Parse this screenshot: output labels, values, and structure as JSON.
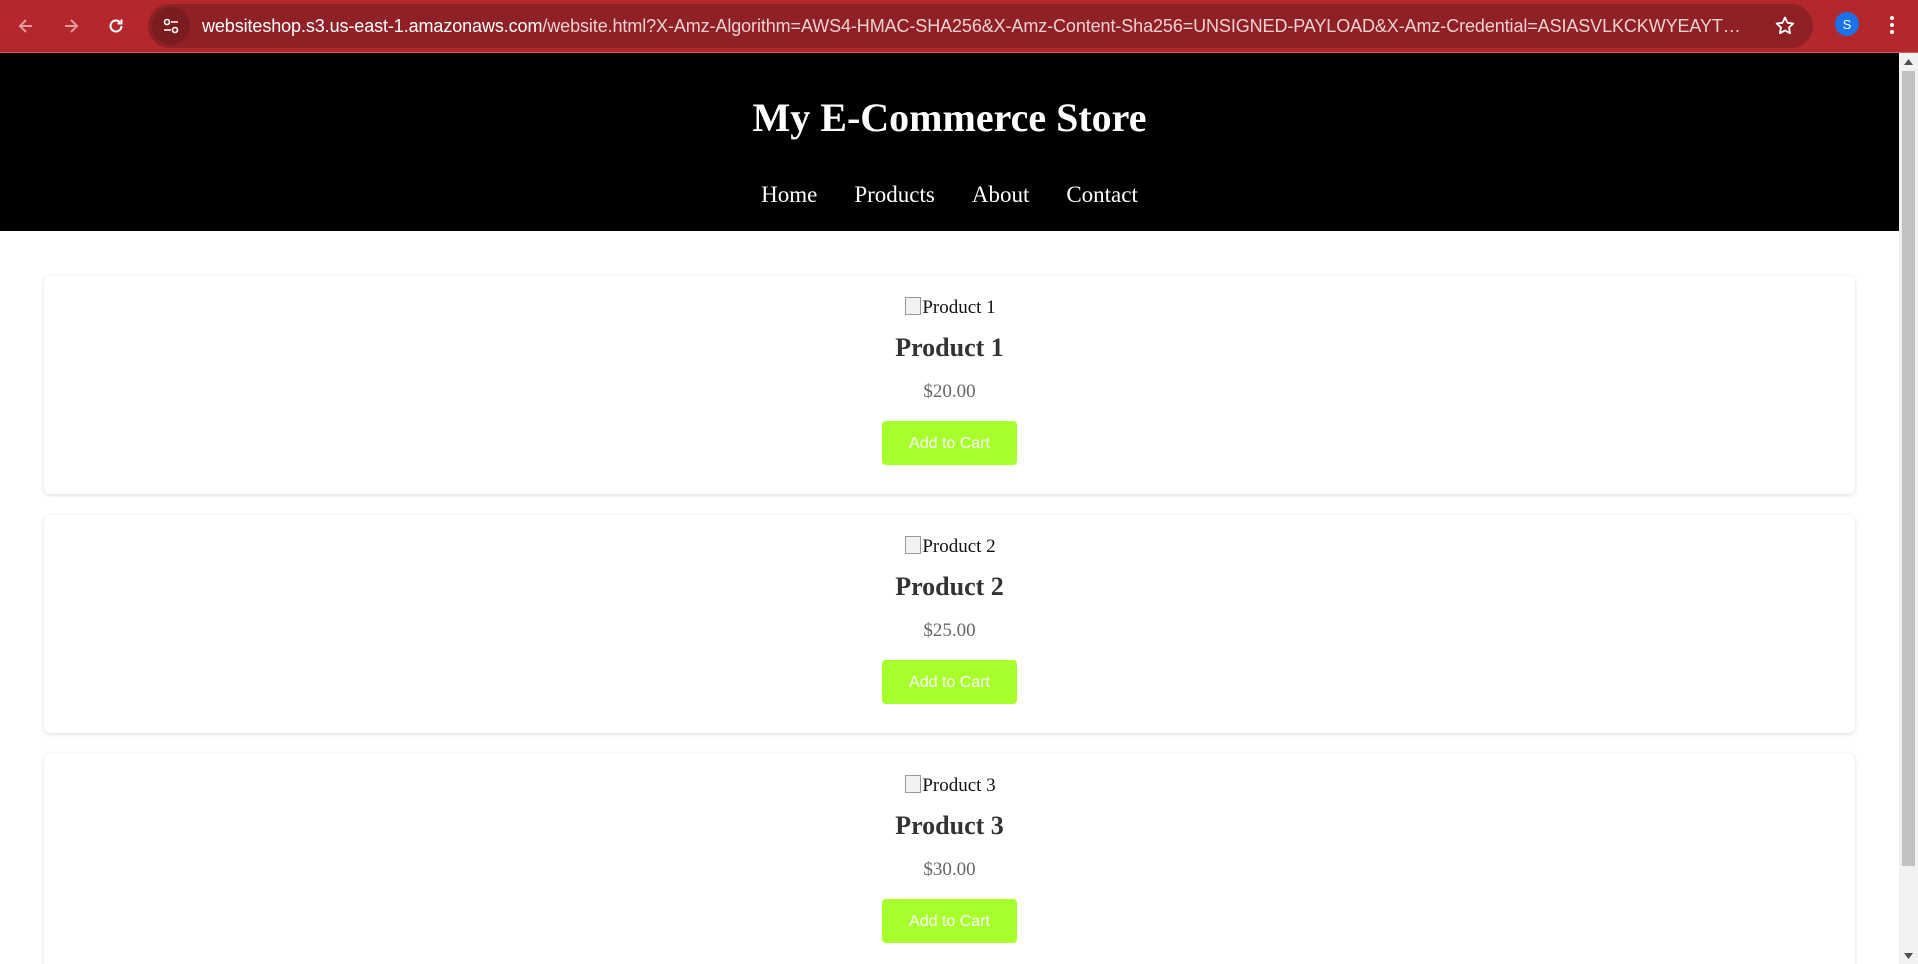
{
  "browser": {
    "url_host": "websiteshop.s3.us-east-1.amazonaws.com",
    "url_rest": "/website.html?X-Amz-Algorithm=AWS4-HMAC-SHA256&X-Amz-Content-Sha256=UNSIGNED-PAYLOAD&X-Amz-Credential=ASIASVLKCKWYEAYTQRMO%2F2...",
    "profile_initial": "S",
    "chrome_color": "#b3272d"
  },
  "site": {
    "title": "My E-Commerce Store",
    "nav": [
      "Home",
      "Products",
      "About",
      "Contact"
    ]
  },
  "products": [
    {
      "image_alt": "Product 1",
      "name": "Product 1",
      "price": "$20.00",
      "button": "Add to Cart"
    },
    {
      "image_alt": "Product 2",
      "name": "Product 2",
      "price": "$25.00",
      "button": "Add to Cart"
    },
    {
      "image_alt": "Product 3",
      "name": "Product 3",
      "price": "$30.00",
      "button": "Add to Cart"
    }
  ],
  "colors": {
    "header_bg": "#000000",
    "button_bg": "#a7ff2c"
  }
}
